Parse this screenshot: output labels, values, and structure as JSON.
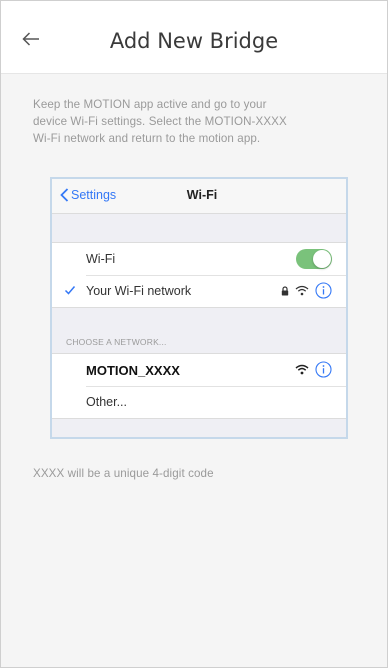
{
  "header": {
    "title": "Add New Bridge",
    "back_icon": "arrow-left-icon"
  },
  "instructions": {
    "line1": "Keep the MOTION app active and go to your",
    "line2": "device Wi-Fi settings. Select the MOTION-XXXX",
    "line3": "Wi-Fi network and return to the motion app."
  },
  "ios": {
    "back_label": "Settings",
    "title": "Wi-Fi",
    "wifi_row_label": "Wi-Fi",
    "wifi_toggle_on": true,
    "connected_network": "Your Wi-Fi network",
    "section_header": "CHOOSE A NETWORK...",
    "networks": [
      {
        "name": "MOTION_XXXX"
      }
    ],
    "other_label": "Other..."
  },
  "footnote": "XXXX will be a unique 4-digit code",
  "colors": {
    "ios_blue": "#3478f6",
    "toggle_green": "#7ac27b",
    "card_border": "#c5d8ea"
  }
}
